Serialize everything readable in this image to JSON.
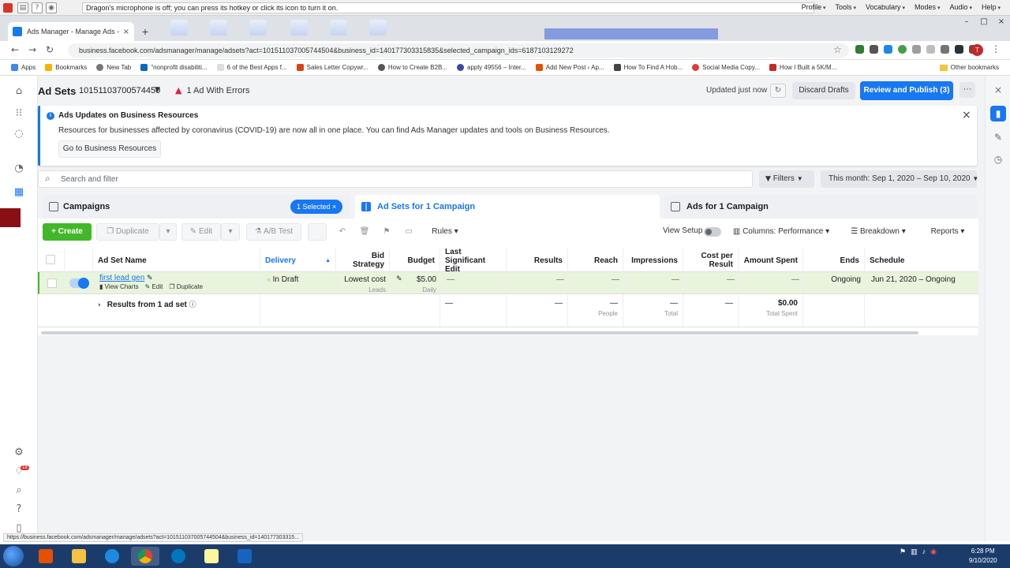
{
  "dragon": {
    "message": "Dragon's microphone is off; you can press its hotkey or click its icon to turn it on.",
    "menu": [
      "Profile",
      "Tools",
      "Vocabulary",
      "Modes",
      "Audio",
      "Help"
    ]
  },
  "browser": {
    "tab_title": "Ads Manager - Manage Ads - Ad",
    "url": "business.facebook.com/adsmanager/manage/adsets?act=101511037005744504&business_id=140177303315835&selected_campaign_ids=6187103129272",
    "bookmarks": [
      "Apps",
      "Bookmarks",
      "New Tab",
      "\"nonprofit disabiliti...",
      "6 of the Best Apps f...",
      "Sales Letter Copywr...",
      "How to Create B2B...",
      "apply 49556 – Inter...",
      "Add New Post ‹ Ap...",
      "How To Find A Hob...",
      "Social Media Copy...",
      "How I Built a 5K/M..."
    ],
    "other_bookmarks": "Other bookmarks",
    "profile_initial": "T",
    "status_url": "https://business.facebook.com/adsmanager/manage/adsets?act=101511037005744504&business_id=140177303315..."
  },
  "header": {
    "title": "Ad Sets",
    "account_id": "10151103700574450",
    "errors": "1 Ad With Errors",
    "updated": "Updated just now",
    "discard": "Discard Drafts",
    "publish": "Review and Publish (3)",
    "more": "···"
  },
  "banner": {
    "title": "Ads Updates on Business Resources",
    "text": "Resources for businesses affected by coronavirus (COVID-19) are now all in one place. You can find Ads Manager updates and tools on Business Resources.",
    "button": "Go to Business Resources"
  },
  "search": {
    "placeholder": "Search and filter",
    "filters": "Filters",
    "date_range": "This month: Sep 1, 2020 – Sep 10, 2020"
  },
  "level_tabs": {
    "campaigns": "Campaigns",
    "selected": "1 Selected",
    "adsets": "Ad Sets for 1 Campaign",
    "ads": "Ads for 1 Campaign"
  },
  "toolbar": {
    "create": "Create",
    "duplicate": "Duplicate",
    "edit": "Edit",
    "ab_test": "A/B Test",
    "rules": "Rules",
    "view_setup": "View Setup",
    "columns": "Columns: Performance",
    "breakdown": "Breakdown",
    "reports": "Reports"
  },
  "table": {
    "headers": {
      "name": "Ad Set Name",
      "delivery": "Delivery",
      "bid": "Bid Strategy",
      "budget": "Budget",
      "last_edit": "Last Significant Edit",
      "results": "Results",
      "reach": "Reach",
      "impressions": "Impressions",
      "cpr": "Cost per Result",
      "spent": "Amount Spent",
      "ends": "Ends",
      "schedule": "Schedule"
    },
    "row": {
      "name": "first lead gen",
      "actions": [
        "View Charts",
        "Edit",
        "Duplicate"
      ],
      "delivery": "In Draft",
      "bid": "Lowest cost",
      "bid_sub": "Leads",
      "budget": "$5.00",
      "budget_sub": "Daily",
      "last_edit": "—",
      "results": "—",
      "reach": "—",
      "impressions": "—",
      "cpr": "—",
      "spent": "—",
      "ends": "Ongoing",
      "schedule": "Jun 21, 2020 – Ongoing"
    },
    "summary": {
      "label": "Results from 1 ad set",
      "last_edit": "—",
      "results": "—",
      "reach": "—",
      "reach_sub": "People",
      "impressions": "—",
      "impressions_sub": "Total",
      "cpr": "—",
      "spent": "$0.00",
      "spent_sub": "Total Spent"
    }
  },
  "left_rail": {
    "notification_count": "18"
  },
  "clock": {
    "time": "6:28 PM",
    "date": "9/10/2020"
  }
}
